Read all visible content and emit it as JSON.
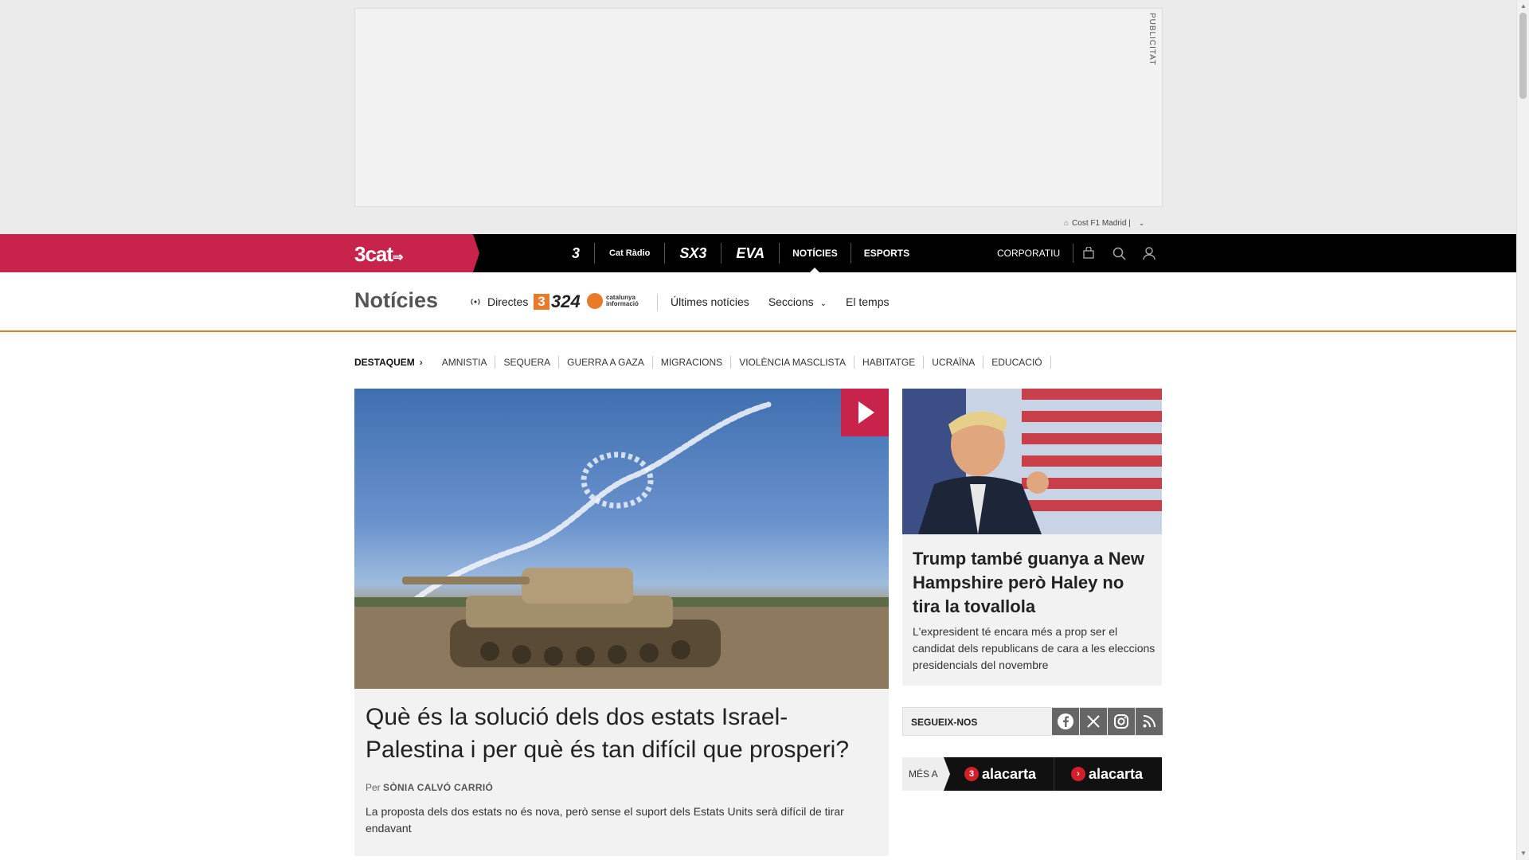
{
  "ad": {
    "vertical_label": "PUBLICITAT",
    "caption": "Cost F1 Madrid |"
  },
  "topnav": {
    "brand": "3cat",
    "channels": [
      "3",
      "Cat Ràdio",
      "SX3",
      "EVA"
    ],
    "links": [
      "NOTÍCIES",
      "ESPORTS"
    ],
    "active": "NOTÍCIES",
    "corporatiu": "CORPORATIU",
    "icons": [
      "shopping-bag-icon",
      "search-icon",
      "user-icon"
    ]
  },
  "section": {
    "title": "Notícies",
    "directes": "Directes",
    "logo_324": "324",
    "catinfo_line1": "catalunya",
    "catinfo_line2": "informació",
    "links": {
      "ultimes": "Últimes notícies",
      "seccions": "Seccions",
      "temps": "El temps"
    }
  },
  "tags": {
    "label": "DESTAQUEM",
    "items": [
      "AMNISTIA",
      "SEQUERA",
      "GUERRA A GAZA",
      "MIGRACIONS",
      "VIOLÈNCIA MASCLISTA",
      "HABITATGE",
      "UCRAÏNA",
      "EDUCACIÓ"
    ]
  },
  "main_article": {
    "title": "Què és la solució dels dos estats Israel-Palestina i per què és tan difícil que prosperi?",
    "byline_prefix": "Per",
    "author": "SÒNIA CALVÓ CARRIÓ",
    "summary": "La proposta dels dos estats no és nova, però sense el suport dels Estats Units serà difícil de tirar endavant"
  },
  "side_article": {
    "title": "Trump també guanya a New Hampshire però Haley no tira la tovallola",
    "summary": "L'expresident té encara més a prop ser el candidat dels republicans de cara a les eleccions presidencials del novembre"
  },
  "follow": {
    "label": "SEGUEIX-NOS",
    "networks": [
      "facebook-icon",
      "x-icon",
      "instagram-icon",
      "rss-icon"
    ]
  },
  "mesa": {
    "label": "MÉS A",
    "items": [
      "alacarta",
      "alacarta"
    ]
  },
  "colors": {
    "brand": "#c8234b",
    "accent_orange": "#e87a2a",
    "nav_bg": "#000000"
  }
}
